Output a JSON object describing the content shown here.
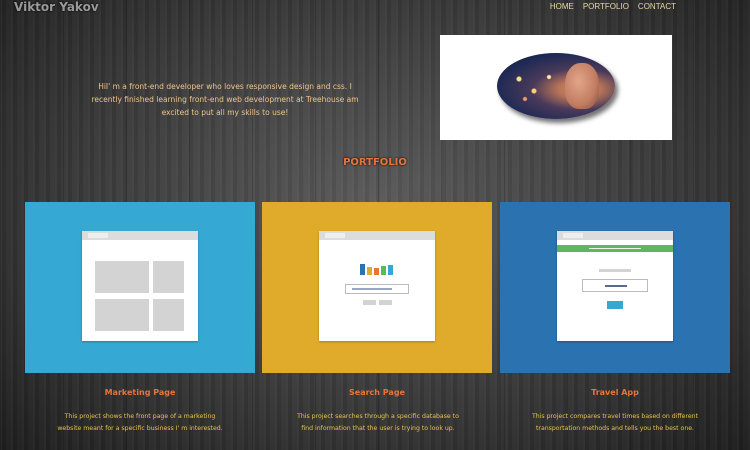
{
  "header": {
    "logo": "Viktor Yakov",
    "nav": [
      "HOME",
      "PORTFOLIO",
      "CONTACT"
    ]
  },
  "intro": {
    "text": "HiI' m a front-end developer who loves responsive design and css. I recently finished learning front-end web development at Treehouse am excited to put all my skills to use!"
  },
  "portfolio": {
    "title": "PORTFOLIO",
    "projects": [
      {
        "title": "Marketing Page",
        "description": "This project shows the front page of a marketing website meant for a specific business I' m interested.",
        "color": "#35a9d4"
      },
      {
        "title": "Search Page",
        "description": "This project searches through a specific database to find information that the user is trying to look up.",
        "color": "#e0ab2a"
      },
      {
        "title": "Travel App",
        "description": "This project compares travel times based on different transportation methods and tells you the best one.",
        "color": "#2b72b0"
      }
    ]
  },
  "colors": {
    "accent": "#e8743a",
    "nav_text": "#e8d8a0",
    "intro_text": "#f0c48a",
    "description_text": "#e8c24a"
  }
}
